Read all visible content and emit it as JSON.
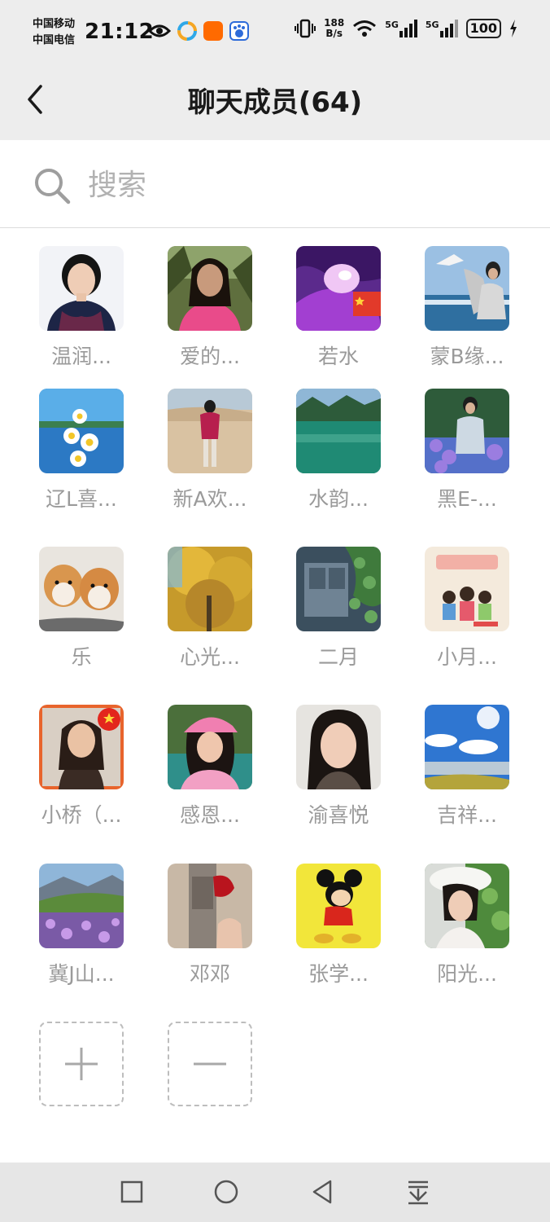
{
  "status_bar": {
    "carrier_1": "中国移动",
    "carrier_2": "中国电信",
    "time": "21:12",
    "net_speed_value": "188",
    "net_speed_unit": "B/s",
    "signal_1_label": "5G",
    "signal_2_label": "5G",
    "battery": "100"
  },
  "header": {
    "title": "聊天成员(64)"
  },
  "search": {
    "placeholder": "搜索"
  },
  "members": [
    {
      "name": "温润...",
      "avatar": "portrait-woman-dark-dress"
    },
    {
      "name": "爱的...",
      "avatar": "woman-pink-shirt-trees"
    },
    {
      "name": "若水",
      "avatar": "purple-flower-flag"
    },
    {
      "name": "蒙B缘...",
      "avatar": "woman-with-bird-sea"
    },
    {
      "name": "辽L喜...",
      "avatar": "daisies-lake"
    },
    {
      "name": "新A欢...",
      "avatar": "woman-desert"
    },
    {
      "name": "水韵...",
      "avatar": "green-lake"
    },
    {
      "name": "黑E-...",
      "avatar": "woman-flower-garden"
    },
    {
      "name": "乐",
      "avatar": "two-shiba-dogs"
    },
    {
      "name": "心光...",
      "avatar": "yellow-ginkgo-tree"
    },
    {
      "name": "二月",
      "avatar": "window-ivy"
    },
    {
      "name": "小月...",
      "avatar": "family-cartoon-poster"
    },
    {
      "name": "小桥（...",
      "avatar": "woman-portrait-flag-frame"
    },
    {
      "name": "感恩...",
      "avatar": "woman-pink-cap"
    },
    {
      "name": "渝喜悦",
      "avatar": "woman-short-hair"
    },
    {
      "name": "吉祥...",
      "avatar": "blue-sky-clouds"
    },
    {
      "name": "冀J山...",
      "avatar": "purple-crocus-field"
    },
    {
      "name": "邓邓",
      "avatar": "hand-with-rose"
    },
    {
      "name": "张学...",
      "avatar": "mickey-mouse"
    },
    {
      "name": "阳光...",
      "avatar": "woman-white-hat"
    }
  ],
  "actions": {
    "add_icon": "plus-icon",
    "remove_icon": "minus-icon"
  },
  "system_nav": [
    "recent-apps-icon",
    "home-icon",
    "back-icon",
    "notification-pull-icon"
  ]
}
